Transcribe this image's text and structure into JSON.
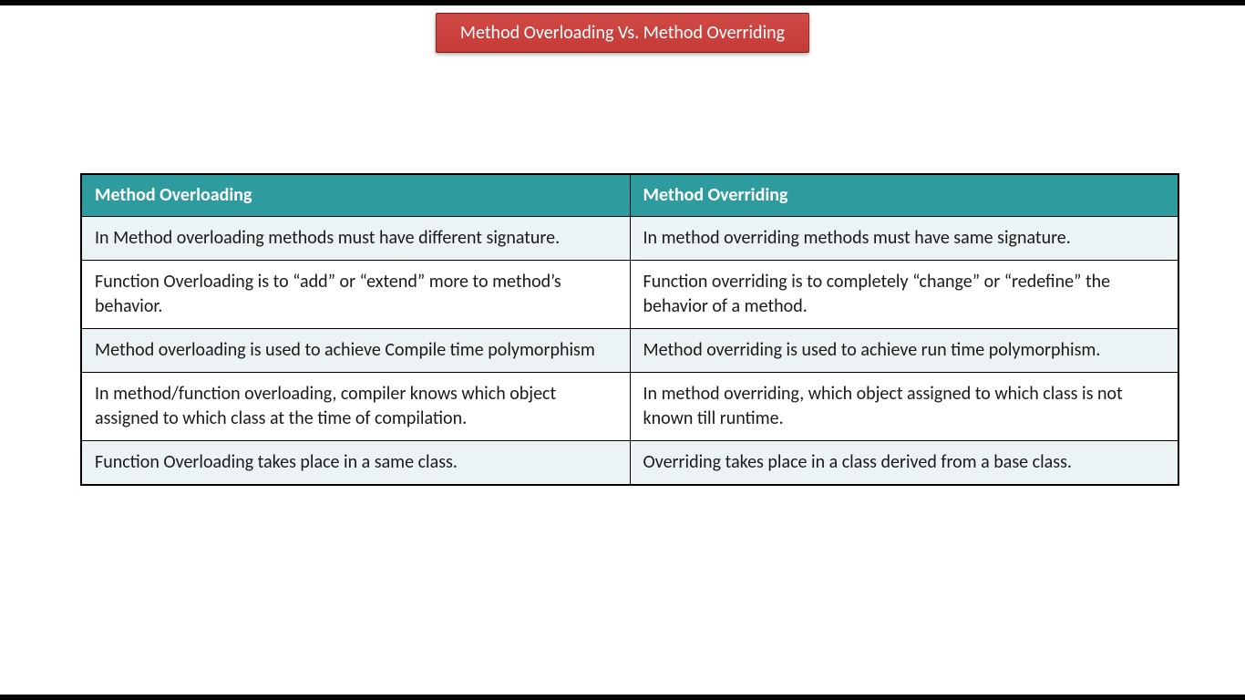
{
  "title": "Method Overloading Vs. Method Overriding",
  "table": {
    "headers": {
      "col1": "Method Overloading",
      "col2": "Method Overriding"
    },
    "rows": [
      {
        "col1": "In Method overloading methods must have different signature.",
        "col2": "In method overriding methods must have same signature."
      },
      {
        "col1": "Function Overloading is to “add” or “extend” more to method’s behavior.",
        "col2": "Function overriding is to completely “change” or “redefine” the behavior of a method."
      },
      {
        "col1": "Method overloading is used to achieve Compile time polymorphism",
        "col2": "Method overriding is used to achieve run time polymorphism."
      },
      {
        "col1": "In method/function overloading, compiler knows which object assigned to which class at the time of compilation.",
        "col2": "In method overriding, which object assigned to which class is not known till runtime."
      },
      {
        "col1": "Function Overloading takes place in a same class.",
        "col2": "Overriding takes place in a class derived from a base class."
      }
    ]
  },
  "chart_data": {
    "type": "table",
    "title": "Method Overloading Vs. Method Overriding",
    "columns": [
      "Method Overloading",
      "Method Overriding"
    ],
    "rows": [
      [
        "In Method overloading methods must have different signature.",
        "In method overriding methods must have same signature."
      ],
      [
        "Function Overloading is to “add” or “extend” more to method’s behavior.",
        "Function overriding is to completely “change” or “redefine” the behavior of a method."
      ],
      [
        "Method overloading is used to achieve Compile time polymorphism",
        "Method overriding is used to achieve run time polymorphism."
      ],
      [
        "In method/function overloading, compiler knows which object assigned to which class at the time of compilation.",
        "In method overriding, which object assigned to which class is not known till runtime."
      ],
      [
        "Function Overloading takes place in a same class.",
        "Overriding takes place in a class derived from a base class."
      ]
    ]
  }
}
